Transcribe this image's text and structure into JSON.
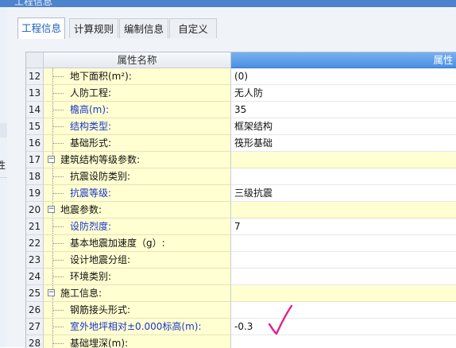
{
  "window": {
    "title": "工程信息"
  },
  "side": {
    "char": "性"
  },
  "tabs": [
    {
      "label": "工程信息",
      "active": true
    },
    {
      "label": "计算规则",
      "active": false
    },
    {
      "label": "编制信息",
      "active": false
    },
    {
      "label": "自定义",
      "active": false
    }
  ],
  "grid": {
    "header_name": "属性名称",
    "header_value": "属性值",
    "rows": [
      {
        "num": "12",
        "name": "地下面积(m²):",
        "value": "(0)",
        "blue": false,
        "group": false
      },
      {
        "num": "13",
        "name": "人防工程:",
        "value": "无人防",
        "blue": false,
        "group": false
      },
      {
        "num": "14",
        "name": "檐高(m):",
        "value": "35",
        "blue": true,
        "group": false
      },
      {
        "num": "15",
        "name": "结构类型:",
        "value": "框架结构",
        "blue": true,
        "group": false
      },
      {
        "num": "16",
        "name": "基础形式:",
        "value": "筏形基础",
        "blue": false,
        "group": false
      },
      {
        "num": "17",
        "name": "建筑结构等级参数:",
        "value": "",
        "blue": false,
        "group": true
      },
      {
        "num": "18",
        "name": "抗震设防类别:",
        "value": "",
        "blue": false,
        "group": false
      },
      {
        "num": "19",
        "name": "抗震等级:",
        "value": "三级抗震",
        "blue": true,
        "group": false
      },
      {
        "num": "20",
        "name": "地震参数:",
        "value": "",
        "blue": false,
        "group": true
      },
      {
        "num": "21",
        "name": "设防烈度:",
        "value": "7",
        "blue": true,
        "group": false
      },
      {
        "num": "22",
        "name": "基本地震加速度（g）:",
        "value": "",
        "blue": false,
        "group": false
      },
      {
        "num": "23",
        "name": "设计地震分组:",
        "value": "",
        "blue": false,
        "group": false
      },
      {
        "num": "24",
        "name": "环境类别:",
        "value": "",
        "blue": false,
        "group": false
      },
      {
        "num": "25",
        "name": "施工信息:",
        "value": "",
        "blue": false,
        "group": true
      },
      {
        "num": "26",
        "name": "钢筋接头形式:",
        "value": "",
        "blue": false,
        "group": false
      },
      {
        "num": "27",
        "name": "室外地坪相对±0.000标高(m):",
        "value": "-0.3",
        "blue": true,
        "group": false
      },
      {
        "num": "28",
        "name": "基础埋深(m):",
        "value": "",
        "blue": false,
        "group": false
      }
    ]
  },
  "annotation": {
    "mark": "checkmark",
    "color": "#e0208e"
  },
  "colors": {
    "accent_blue": "#1a36c9",
    "header_blue": "#4c90e2",
    "name_bg": "#ffffd2"
  }
}
